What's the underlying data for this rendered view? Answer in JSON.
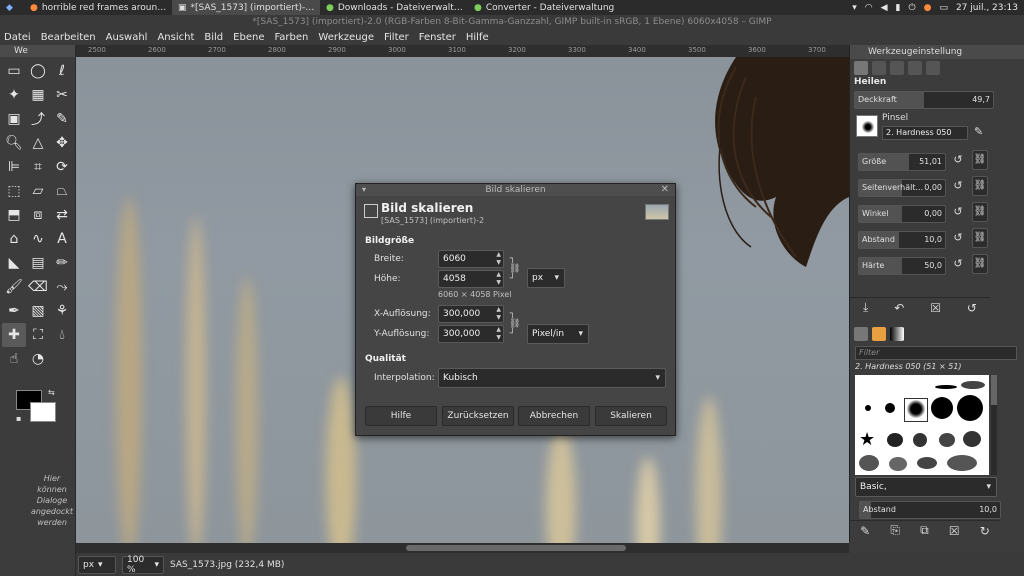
{
  "taskbar": {
    "tasks": [
      "horrible red frames aroun…",
      "*[SAS_1573] (importiert)-…",
      "Downloads - Dateiverwalt…",
      "Converter - Dateiverwaltung"
    ],
    "clock": "27 juil., 23:13"
  },
  "window": {
    "title": "*[SAS_1573] (importiert)-2.0 (RGB-Farben 8-Bit-Gamma-Ganzzahl, GIMP built-in sRGB, 1 Ebene) 6060x4058 – GIMP"
  },
  "menu": [
    "Datei",
    "Bearbeiten",
    "Auswahl",
    "Ansicht",
    "Bild",
    "Ebene",
    "Farben",
    "Werkzeuge",
    "Filter",
    "Fenster",
    "Hilfe"
  ],
  "toolbox": {
    "title": "We",
    "hint": "Hier können Dialoge angedockt werden"
  },
  "ruler": {
    "ticks": [
      "2500",
      "2600",
      "2700",
      "2800",
      "2900",
      "3000",
      "3100",
      "3200",
      "3300",
      "3400",
      "3500",
      "3600",
      "3700"
    ]
  },
  "statusbar": {
    "unit": "px",
    "zoom": "100 %",
    "file": "SAS_1573.jpg (232,4 MB)"
  },
  "dock": {
    "title": "Werkzeugeinstellung",
    "tool": "Heilen",
    "deckkraft_label": "Deckkraft",
    "deckkraft_value": "49,7",
    "pinsel_label": "Pinsel",
    "pinsel_value": "2. Hardness 050",
    "sliders": [
      {
        "label": "Größe",
        "value": "51,01"
      },
      {
        "label": "Seitenverhält...",
        "value": "0,00"
      },
      {
        "label": "Winkel",
        "value": "0,00"
      },
      {
        "label": "Abstand",
        "value": "10,0"
      },
      {
        "label": "Härte",
        "value": "50,0"
      }
    ],
    "filter_placeholder": "Filter",
    "brush_name": "2. Hardness 050 (51 × 51)",
    "brush_tag": "Basic,",
    "abstand_label": "Abstand",
    "abstand_value": "10,0"
  },
  "dialog": {
    "window_title": "Bild skalieren",
    "heading": "Bild skalieren",
    "subtitle": "[SAS_1573] (importiert)-2",
    "section_size": "Bildgröße",
    "width_label": "Breite:",
    "width_value": "6060",
    "height_label": "Höhe:",
    "height_value": "4058",
    "size_unit": "px",
    "pixel_info": "6060 × 4058 Pixel",
    "xres_label": "X-Auflösung:",
    "xres_value": "300,000",
    "yres_label": "Y-Auflösung:",
    "yres_value": "300,000",
    "res_unit": "Pixel/in",
    "section_quality": "Qualität",
    "interp_label": "Interpolation:",
    "interp_value": "Kubisch",
    "buttons": {
      "help": "Hilfe",
      "reset": "Zurücksetzen",
      "cancel": "Abbrechen",
      "scale": "Skalieren"
    }
  },
  "colors": {
    "foreground": "#000000",
    "background": "#ffffff"
  }
}
